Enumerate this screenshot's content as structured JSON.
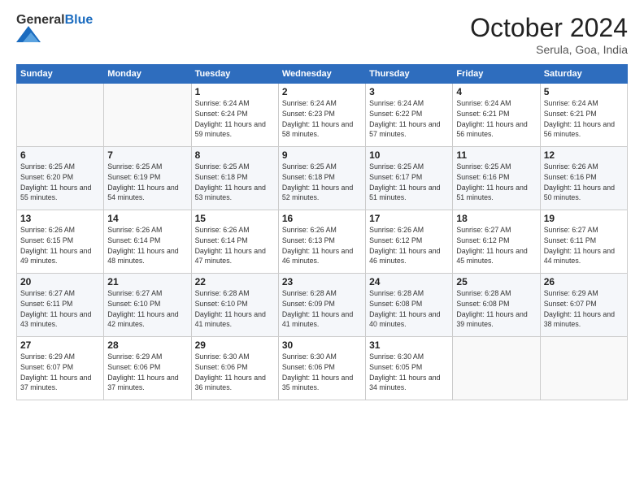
{
  "header": {
    "logo_line1": "General",
    "logo_line2": "Blue",
    "month": "October 2024",
    "location": "Serula, Goa, India"
  },
  "weekdays": [
    "Sunday",
    "Monday",
    "Tuesday",
    "Wednesday",
    "Thursday",
    "Friday",
    "Saturday"
  ],
  "weeks": [
    [
      {
        "day": "",
        "info": ""
      },
      {
        "day": "",
        "info": ""
      },
      {
        "day": "1",
        "info": "Sunrise: 6:24 AM\nSunset: 6:24 PM\nDaylight: 11 hours and 59 minutes."
      },
      {
        "day": "2",
        "info": "Sunrise: 6:24 AM\nSunset: 6:23 PM\nDaylight: 11 hours and 58 minutes."
      },
      {
        "day": "3",
        "info": "Sunrise: 6:24 AM\nSunset: 6:22 PM\nDaylight: 11 hours and 57 minutes."
      },
      {
        "day": "4",
        "info": "Sunrise: 6:24 AM\nSunset: 6:21 PM\nDaylight: 11 hours and 56 minutes."
      },
      {
        "day": "5",
        "info": "Sunrise: 6:24 AM\nSunset: 6:21 PM\nDaylight: 11 hours and 56 minutes."
      }
    ],
    [
      {
        "day": "6",
        "info": "Sunrise: 6:25 AM\nSunset: 6:20 PM\nDaylight: 11 hours and 55 minutes."
      },
      {
        "day": "7",
        "info": "Sunrise: 6:25 AM\nSunset: 6:19 PM\nDaylight: 11 hours and 54 minutes."
      },
      {
        "day": "8",
        "info": "Sunrise: 6:25 AM\nSunset: 6:18 PM\nDaylight: 11 hours and 53 minutes."
      },
      {
        "day": "9",
        "info": "Sunrise: 6:25 AM\nSunset: 6:18 PM\nDaylight: 11 hours and 52 minutes."
      },
      {
        "day": "10",
        "info": "Sunrise: 6:25 AM\nSunset: 6:17 PM\nDaylight: 11 hours and 51 minutes."
      },
      {
        "day": "11",
        "info": "Sunrise: 6:25 AM\nSunset: 6:16 PM\nDaylight: 11 hours and 51 minutes."
      },
      {
        "day": "12",
        "info": "Sunrise: 6:26 AM\nSunset: 6:16 PM\nDaylight: 11 hours and 50 minutes."
      }
    ],
    [
      {
        "day": "13",
        "info": "Sunrise: 6:26 AM\nSunset: 6:15 PM\nDaylight: 11 hours and 49 minutes."
      },
      {
        "day": "14",
        "info": "Sunrise: 6:26 AM\nSunset: 6:14 PM\nDaylight: 11 hours and 48 minutes."
      },
      {
        "day": "15",
        "info": "Sunrise: 6:26 AM\nSunset: 6:14 PM\nDaylight: 11 hours and 47 minutes."
      },
      {
        "day": "16",
        "info": "Sunrise: 6:26 AM\nSunset: 6:13 PM\nDaylight: 11 hours and 46 minutes."
      },
      {
        "day": "17",
        "info": "Sunrise: 6:26 AM\nSunset: 6:12 PM\nDaylight: 11 hours and 46 minutes."
      },
      {
        "day": "18",
        "info": "Sunrise: 6:27 AM\nSunset: 6:12 PM\nDaylight: 11 hours and 45 minutes."
      },
      {
        "day": "19",
        "info": "Sunrise: 6:27 AM\nSunset: 6:11 PM\nDaylight: 11 hours and 44 minutes."
      }
    ],
    [
      {
        "day": "20",
        "info": "Sunrise: 6:27 AM\nSunset: 6:11 PM\nDaylight: 11 hours and 43 minutes."
      },
      {
        "day": "21",
        "info": "Sunrise: 6:27 AM\nSunset: 6:10 PM\nDaylight: 11 hours and 42 minutes."
      },
      {
        "day": "22",
        "info": "Sunrise: 6:28 AM\nSunset: 6:10 PM\nDaylight: 11 hours and 41 minutes."
      },
      {
        "day": "23",
        "info": "Sunrise: 6:28 AM\nSunset: 6:09 PM\nDaylight: 11 hours and 41 minutes."
      },
      {
        "day": "24",
        "info": "Sunrise: 6:28 AM\nSunset: 6:08 PM\nDaylight: 11 hours and 40 minutes."
      },
      {
        "day": "25",
        "info": "Sunrise: 6:28 AM\nSunset: 6:08 PM\nDaylight: 11 hours and 39 minutes."
      },
      {
        "day": "26",
        "info": "Sunrise: 6:29 AM\nSunset: 6:07 PM\nDaylight: 11 hours and 38 minutes."
      }
    ],
    [
      {
        "day": "27",
        "info": "Sunrise: 6:29 AM\nSunset: 6:07 PM\nDaylight: 11 hours and 37 minutes."
      },
      {
        "day": "28",
        "info": "Sunrise: 6:29 AM\nSunset: 6:06 PM\nDaylight: 11 hours and 37 minutes."
      },
      {
        "day": "29",
        "info": "Sunrise: 6:30 AM\nSunset: 6:06 PM\nDaylight: 11 hours and 36 minutes."
      },
      {
        "day": "30",
        "info": "Sunrise: 6:30 AM\nSunset: 6:06 PM\nDaylight: 11 hours and 35 minutes."
      },
      {
        "day": "31",
        "info": "Sunrise: 6:30 AM\nSunset: 6:05 PM\nDaylight: 11 hours and 34 minutes."
      },
      {
        "day": "",
        "info": ""
      },
      {
        "day": "",
        "info": ""
      }
    ]
  ]
}
